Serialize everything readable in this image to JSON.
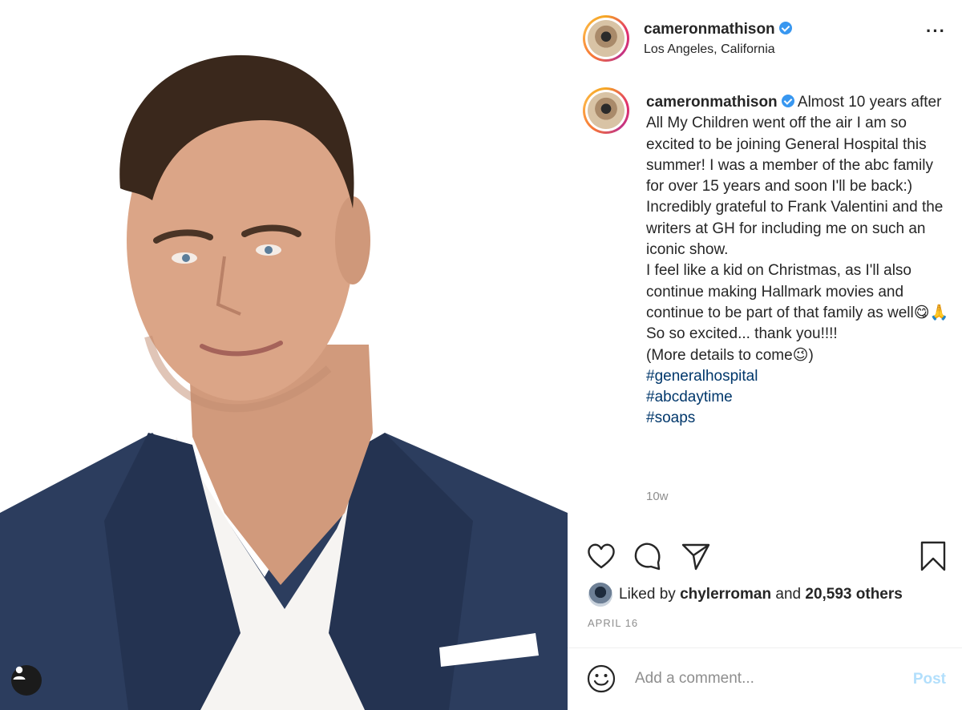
{
  "post": {
    "username": "cameronmathison",
    "location": "Los Angeles, California",
    "more_icon": "more-horizontal-icon",
    "caption_text": "Almost 10 years after All My Children went off the air I am so excited to be joining General Hospital this summer! I was a member of the abc family for over 15 years and soon I'll be back:) Incredibly grateful to Frank Valentini and the writers at GH for including me on such an iconic show.\nI feel like a kid on Christmas, as I'll also continue making Hallmark movies and continue to be part of that family as well😋🙏So so excited... thank you!!!!\n(More details to come😉)",
    "hashtags": [
      "#generalhospital",
      "#abcdaytime",
      "#soaps"
    ],
    "age": "10w",
    "liked_prefix": "Liked by",
    "liked_user": "chylerroman",
    "liked_and": "and",
    "liked_others": "20,593 others",
    "date": "APRIL 16",
    "comment_placeholder": "Add a comment...",
    "post_label": "Post"
  },
  "colors": {
    "accent_blue": "#3897f0",
    "hashtag": "#00376b",
    "muted": "#8e8e8e",
    "post_disabled": "#b2dffc"
  }
}
